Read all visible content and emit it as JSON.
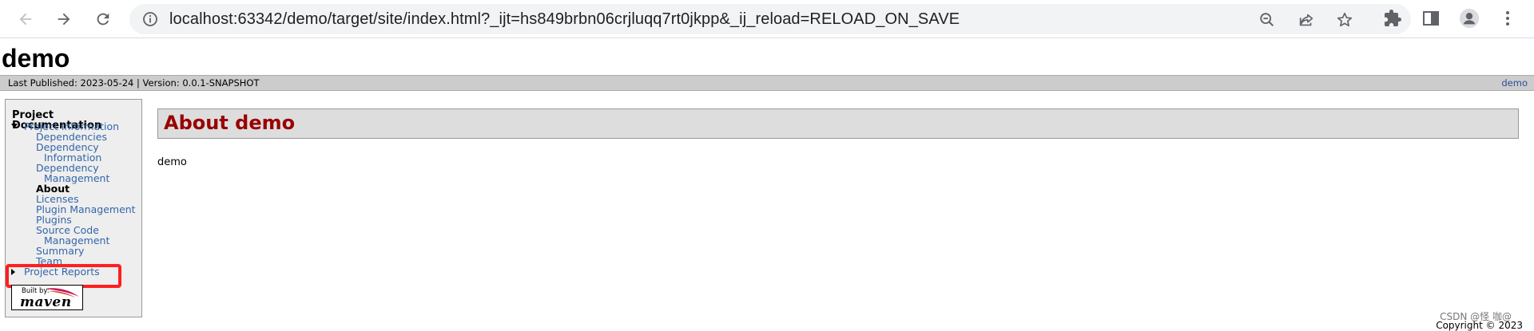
{
  "browser": {
    "url": "localhost:63342/demo/target/site/index.html?_ijt=hs849brbn06crjluqq7rt0jkpp&_ij_reload=RELOAD_ON_SAVE",
    "icons": {
      "back": "arrow-left",
      "forward": "arrow-right",
      "reload": "reload",
      "info": "info-circle",
      "zoom": "zoom-out",
      "share": "share",
      "bookmark": "star",
      "extensions": "puzzle",
      "sidepanel": "side-panel",
      "profile": "person",
      "menu": "kebab"
    }
  },
  "site": {
    "title": "demo",
    "published": "Last Published: 2023-05-24  | Version: 0.0.1-SNAPSHOT",
    "breadcrumb_right": "demo"
  },
  "sidebar": {
    "heading": "Project Documentation",
    "project_info": "Project Information",
    "items": [
      {
        "label": "Dependencies"
      },
      {
        "label": "Dependency"
      },
      {
        "label": "Information"
      },
      {
        "label": "Dependency"
      },
      {
        "label": "Management"
      },
      {
        "label": "About"
      },
      {
        "label": "Licenses"
      },
      {
        "label": "Plugin Management"
      },
      {
        "label": "Plugins"
      },
      {
        "label": "Source Code"
      },
      {
        "label": "Management"
      },
      {
        "label": "Summary"
      },
      {
        "label": "Team"
      }
    ],
    "project_reports": "Project Reports",
    "built_by": "Built by:",
    "maven": "maven"
  },
  "main": {
    "heading": "About demo",
    "body": "demo"
  },
  "footer": {
    "watermark": "CSDN @怪 咖@",
    "copyright": "Copyright © 2023"
  },
  "colors": {
    "link": "#3366aa",
    "heading": "#990000",
    "highlight": "#ff1f1f"
  }
}
